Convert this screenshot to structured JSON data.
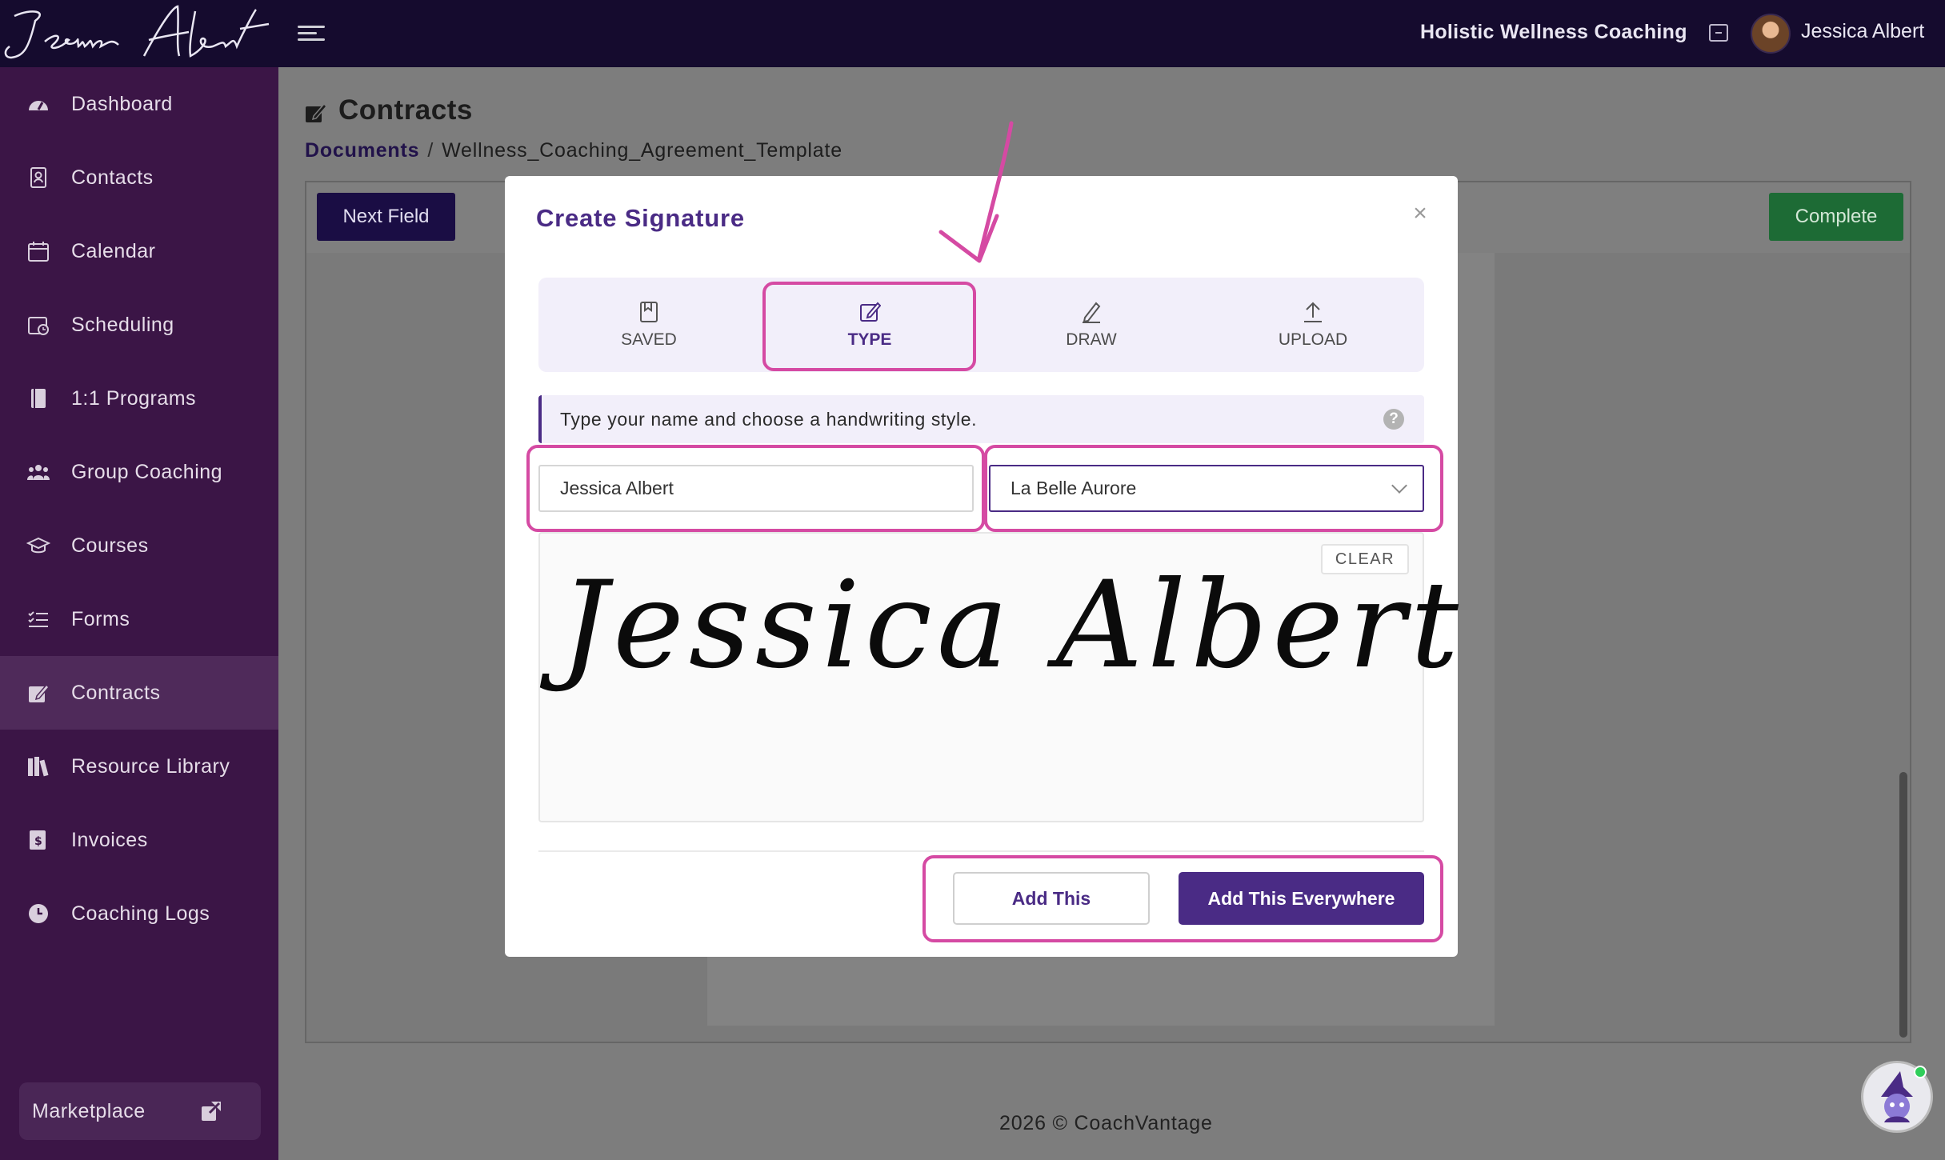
{
  "app": {
    "logo_text": "Jessica Albert",
    "org_name": "Holistic Wellness Coaching",
    "user_name": "Jessica Albert"
  },
  "sidebar": {
    "items": [
      {
        "label": "Dashboard",
        "icon": "dashboard-icon"
      },
      {
        "label": "Contacts",
        "icon": "contacts-icon"
      },
      {
        "label": "Calendar",
        "icon": "calendar-icon"
      },
      {
        "label": "Scheduling",
        "icon": "scheduling-icon"
      },
      {
        "label": "1:1 Programs",
        "icon": "book-icon"
      },
      {
        "label": "Group Coaching",
        "icon": "group-icon"
      },
      {
        "label": "Courses",
        "icon": "graduation-cap-icon"
      },
      {
        "label": "Forms",
        "icon": "list-icon"
      },
      {
        "label": "Contracts",
        "icon": "signature-icon"
      },
      {
        "label": "Resource Library",
        "icon": "library-icon"
      },
      {
        "label": "Invoices",
        "icon": "invoice-icon"
      },
      {
        "label": "Coaching Logs",
        "icon": "clock-icon"
      }
    ],
    "active": "Contracts",
    "marketplace_label": "Marketplace"
  },
  "page": {
    "title": "Contracts",
    "breadcrumb_root": "Documents",
    "breadcrumb_separator": "/",
    "breadcrumb_current": "Wellness_Coaching_Agreement_Template"
  },
  "toolbar": {
    "next_field_label": "Next Field",
    "complete_label": "Complete"
  },
  "modal": {
    "title": "Create Signature",
    "close_glyph": "×",
    "tabs": [
      {
        "label": "SAVED",
        "icon": "bookmark-icon"
      },
      {
        "label": "TYPE",
        "icon": "edit-icon"
      },
      {
        "label": "DRAW",
        "icon": "pen-icon"
      },
      {
        "label": "UPLOAD",
        "icon": "upload-icon"
      }
    ],
    "active_tab": "TYPE",
    "info_text": "Type your name and choose a handwriting style.",
    "help_glyph": "?",
    "name_value": "Jessica Albert",
    "font_value": "La Belle Aurore",
    "clear_label": "CLEAR",
    "signature_preview": "Jessica Albert",
    "add_label": "Add This",
    "add_everywhere_label": "Add This Everywhere"
  },
  "footer": {
    "copyright": "2026 © CoachVantage"
  },
  "colors": {
    "topbar": "#150b2e",
    "sidebar": "#3b1546",
    "accent": "#4a2b85",
    "complete_green": "#1d6b35",
    "highlight": "#d54aa3"
  }
}
